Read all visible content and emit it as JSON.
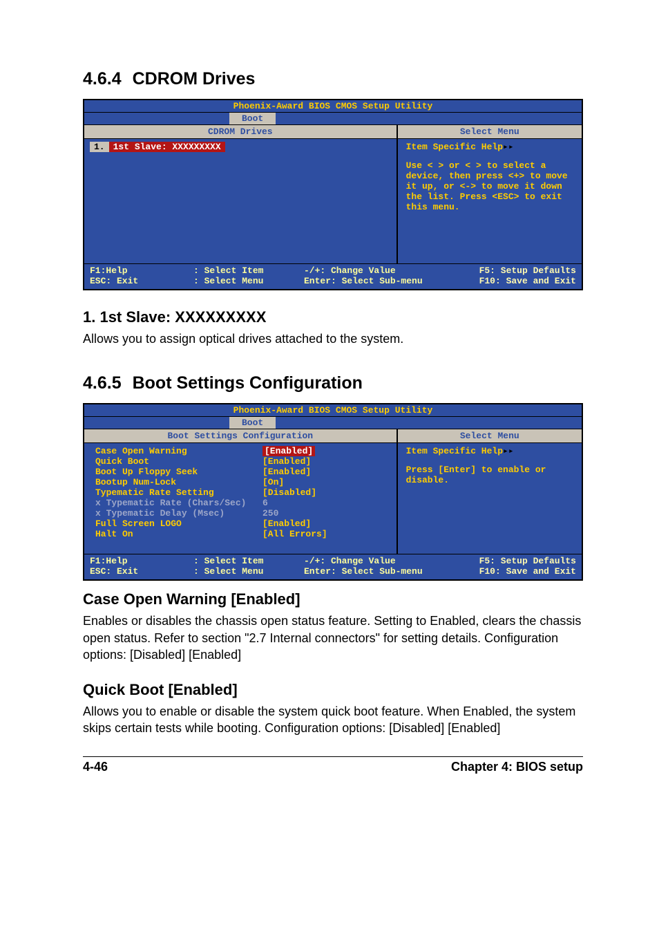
{
  "s1": {
    "num": "4.6.4",
    "title": "CDROM Drives",
    "bios": {
      "title": "Phoenix-Award BIOS CMOS Setup Utility",
      "tab": "Boot",
      "left_head": "CDROM Drives",
      "right_head": "Select Menu",
      "item_idx": "1.",
      "item_txt": "1st Slave: XXXXXXXXX",
      "help_title": "Item Specific Help",
      "help_body": "Use < > or < > to select a device, then press <+> to move it up, or <-> to move it down the list. Press <ESC> to exit this menu.",
      "f": {
        "a1": "F1:Help",
        "a2": "ESC: Exit",
        "b1": ": Select Item",
        "b2": ": Select Menu",
        "c1": "-/+: Change Value",
        "c2": "Enter: Select Sub-menu",
        "d1": "F5: Setup Defaults",
        "d2": "F10: Save and Exit"
      }
    },
    "sub_title": "1. 1st Slave: XXXXXXXXX",
    "sub_body": "Allows you to assign optical drives attached to the system."
  },
  "s2": {
    "num": "4.6.5",
    "title": "Boot Settings Configuration",
    "bios": {
      "title": "Phoenix-Award BIOS CMOS Setup Utility",
      "tab": "Boot",
      "left_head": "Boot Settings Configuration",
      "right_head": "Select Menu",
      "rows": [
        {
          "l": "Case Open Warning",
          "v": "[Enabled]",
          "sel": true
        },
        {
          "l": "Quick Boot",
          "v": "[Enabled]"
        },
        {
          "l": "Boot Up Floppy Seek",
          "v": "[Enabled]"
        },
        {
          "l": "Bootup Num-Lock",
          "v": "[On]"
        },
        {
          "l": "Typematic Rate Setting",
          "v": "[Disabled]"
        },
        {
          "l": "x Typematic Rate (Chars/Sec)",
          "v": "6",
          "dim": true
        },
        {
          "l": "x Typematic Delay (Msec)",
          "v": "250",
          "dim": true
        },
        {
          "l": "Full Screen LOGO",
          "v": "[Enabled]"
        },
        {
          "l": "Halt On",
          "v": "[All Errors]"
        }
      ],
      "help_title": "Item Specific Help",
      "help_body": "Press [Enter] to enable or disable.",
      "f": {
        "a1": "F1:Help",
        "a2": "ESC: Exit",
        "b1": ": Select Item",
        "b2": ": Select Menu",
        "c1": "-/+: Change Value",
        "c2": "Enter: Select Sub-menu",
        "d1": "F5: Setup Defaults",
        "d2": "F10: Save and Exit"
      }
    },
    "opt1_title": "Case Open Warning [Enabled]",
    "opt1_body": "Enables or disables the chassis open status feature. Setting to Enabled, clears the chassis open status. Refer to section \"2.7 Internal connectors\" for setting details. Configuration options: [Disabled] [Enabled]",
    "opt2_title": "Quick Boot [Enabled]",
    "opt2_body": "Allows you to enable or disable the system quick boot feature. When Enabled, the system skips certain tests while booting. Configuration options: [Disabled] [Enabled]"
  },
  "footer": {
    "left": "4-46",
    "right": "Chapter 4: BIOS setup"
  }
}
